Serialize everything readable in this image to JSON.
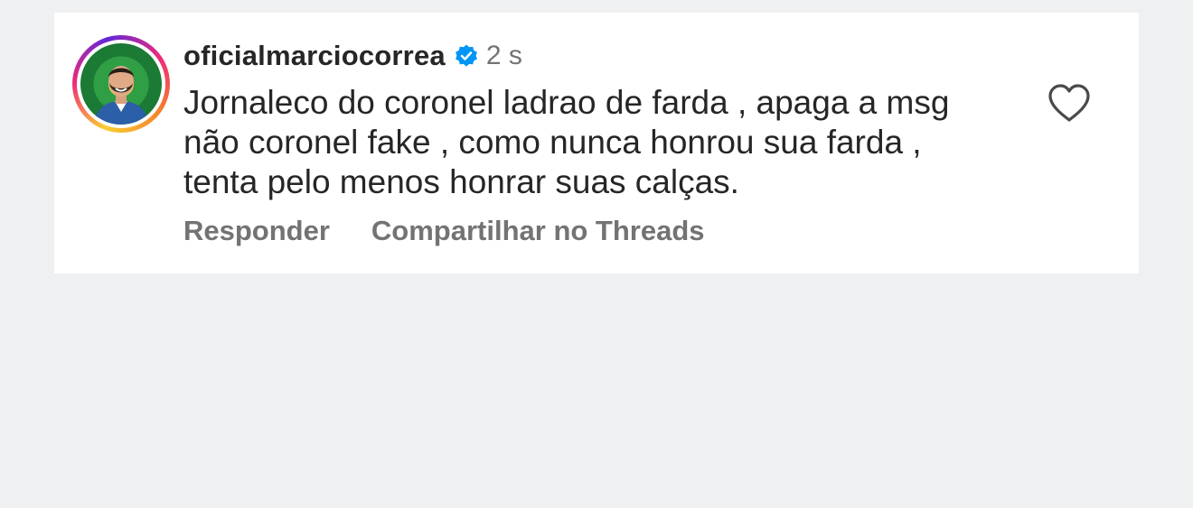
{
  "comment": {
    "username": "oficialmarciocorrea",
    "verified_icon": "verified-badge-icon",
    "time": "2 s",
    "text": "Jornaleco do coronel ladrao de farda , apaga a msg\nnão coronel fake , como nunca honrou sua farda ,\ntenta pelo menos honrar suas calças.",
    "actions": {
      "reply": "Responder",
      "share": "Compartilhar no Threads"
    },
    "like_icon": "heart-outline-icon"
  },
  "colors": {
    "background": "#eff0f2",
    "card": "#ffffff",
    "text_primary": "#262626",
    "text_secondary": "#737373",
    "verified_blue": "#0095f6"
  }
}
